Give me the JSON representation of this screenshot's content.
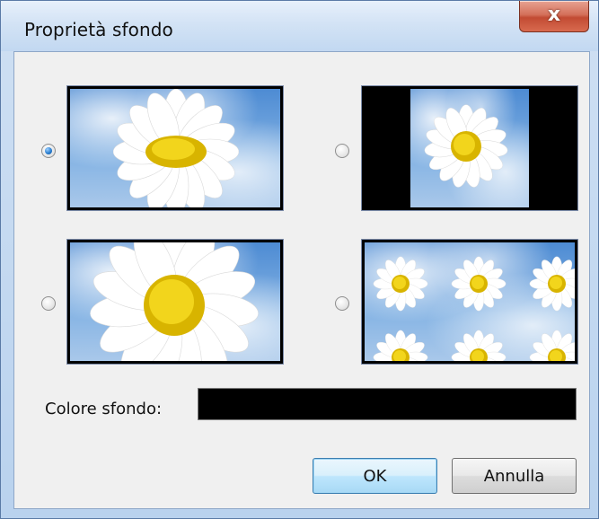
{
  "dialog": {
    "title": "Proprietà sfondo",
    "close_label": "x"
  },
  "options": [
    {
      "id": "stretch",
      "checked": true
    },
    {
      "id": "center",
      "checked": false
    },
    {
      "id": "fill",
      "checked": false
    },
    {
      "id": "tile",
      "checked": false
    }
  ],
  "background_color": {
    "label": "Colore sfondo:",
    "value": "#000000"
  },
  "buttons": {
    "ok": "OK",
    "cancel": "Annulla"
  }
}
